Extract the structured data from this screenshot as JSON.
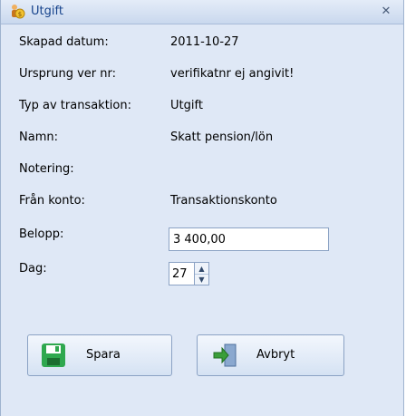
{
  "window": {
    "title": "Utgift",
    "close_symbol": "✕"
  },
  "fields": [
    {
      "label": "Skapad datum:",
      "value": "2011-10-27"
    },
    {
      "label": "Ursprung ver nr:",
      "value": "verifikatnr ej angivit!"
    },
    {
      "label": "Typ av transaktion:",
      "value": "Utgift"
    },
    {
      "label": "Namn:",
      "value": "Skatt pension/lön"
    },
    {
      "label": "Notering:",
      "value": ""
    },
    {
      "label": "Från konto:",
      "value": "Transaktionskonto"
    }
  ],
  "belopp": {
    "label": "Belopp:",
    "value": "3 400,00"
  },
  "dag": {
    "label": "Dag:",
    "value": "27"
  },
  "buttons": {
    "save": "Spara",
    "cancel": "Avbryt"
  },
  "icons": {
    "app": "money-person-icon",
    "save": "floppy-disk-icon",
    "cancel": "exit-door-icon"
  },
  "colors": {
    "title_text": "#15428b",
    "window_bg": "#dfe8f6",
    "save_icon": "#2fa84f",
    "cancel_icon": "#3a9e3a"
  }
}
